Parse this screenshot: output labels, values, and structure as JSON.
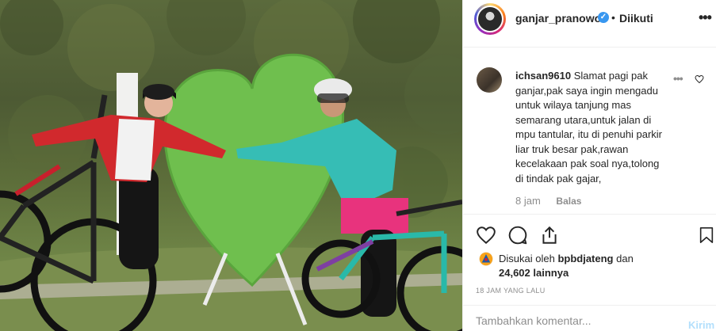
{
  "photo": {
    "description_icon": "photo",
    "heart_color": "#6fbf4e"
  },
  "header": {
    "username": "ganjar_pranowo",
    "verified_icon": "verified-badge-icon",
    "separator": "•",
    "follow_state": "Diikuti",
    "more_label": "•••"
  },
  "comment": {
    "username": "ichsan9610",
    "text": "Slamat pagi pak ganjar,pak saya ingin mengadu untuk wilaya tanjung mas semarang utara,untuk jalan di mpu tantular, itu di penuhi parkir liar truk besar pak,rawan kecelakaan pak soal nya,tolong di tindak pak gajar,",
    "time": "8 jam",
    "reply_label": "Balas",
    "more_label": "•••"
  },
  "actions": {
    "like_icon": "heart-icon",
    "comment_icon": "comment-icon",
    "share_icon": "share-icon",
    "save_icon": "bookmark-icon"
  },
  "likes": {
    "prefix": "Disukai oleh",
    "liker": "bpbdjateng",
    "middle": "dan",
    "others": "24,602 lainnya"
  },
  "timestamp": "18 JAM YANG LALU",
  "add_comment": {
    "placeholder": "Tambahkan komentar...",
    "post_label": "Kirim"
  },
  "colors": {
    "accent_blue": "#3897f0",
    "muted": "#8e8e8e",
    "post_disabled": "#b2dffc"
  }
}
